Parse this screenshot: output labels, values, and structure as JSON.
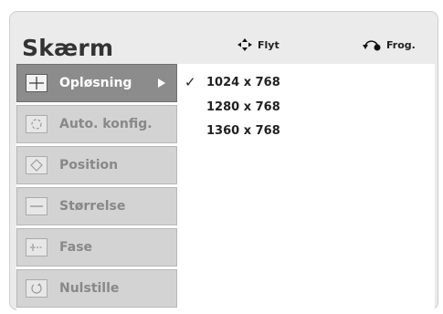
{
  "header": {
    "title": "Skærm",
    "move_label": "Flyt",
    "back_label": "Frog."
  },
  "menu": {
    "items": [
      {
        "label": "Opløsning",
        "icon": "crosshair-icon",
        "active": true
      },
      {
        "label": "Auto. konfig.",
        "icon": "auto-config-icon",
        "active": false
      },
      {
        "label": "Position",
        "icon": "position-icon",
        "active": false
      },
      {
        "label": "Størrelse",
        "icon": "size-icon",
        "active": false
      },
      {
        "label": "Fase",
        "icon": "phase-icon",
        "active": false
      },
      {
        "label": "Nulstille",
        "icon": "reset-icon",
        "active": false
      }
    ]
  },
  "resolution": {
    "options": [
      "1024 x 768",
      "1280 x 768",
      "1360 x 768"
    ],
    "selected_index": 0,
    "check_glyph": "✓"
  },
  "colors": {
    "panel_bg": "#ebebeb",
    "menu_active_bg": "#8c8c8c",
    "menu_inactive_bg": "#d3d3d3",
    "menu_inactive_text": "#888888"
  }
}
